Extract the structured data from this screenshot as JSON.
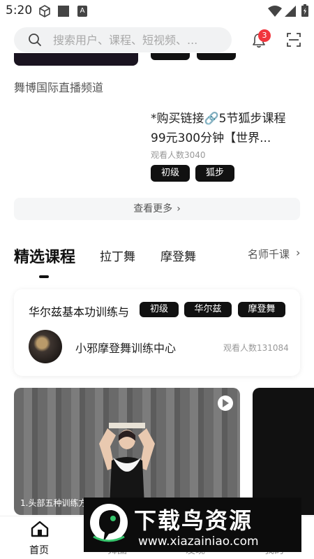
{
  "status_bar": {
    "time": "5:20",
    "app_icon_label": "A"
  },
  "header": {
    "search_placeholder": "搜索用户、课程、短视频、...",
    "notification_count": "3"
  },
  "channel": {
    "title": "舞博国际直播频道"
  },
  "live_course": {
    "title": "*购买链接🔗5节狐步课程99元300分钟【世界...",
    "views": "观看人数3040",
    "tags": [
      "初级",
      "狐步"
    ]
  },
  "see_more": {
    "label": "查看更多",
    "chevron": "›"
  },
  "tabs": {
    "items": [
      "精选课程",
      "拉丁舞",
      "摩登舞",
      "名师千课"
    ],
    "active_index": 0,
    "more_chevron": "›"
  },
  "featured_card": {
    "title": "华尔兹基本功训练与",
    "tags": [
      "初级",
      "华尔兹",
      "摩登舞"
    ],
    "org_name": "小邪摩登舞训练中心",
    "views": "观看人数131084"
  },
  "video": {
    "caption": "1.头部五种训练方"
  },
  "bottom_nav": {
    "items": [
      "首页",
      "舞圈",
      "发现",
      "我的"
    ],
    "active_index": 0
  },
  "watermark": {
    "title": "下载鸟资源",
    "url": "www.xiazainiao.com"
  },
  "colors": {
    "badge": "#f1353d",
    "tag_bg": "#111111",
    "accent_text": "#111111"
  }
}
